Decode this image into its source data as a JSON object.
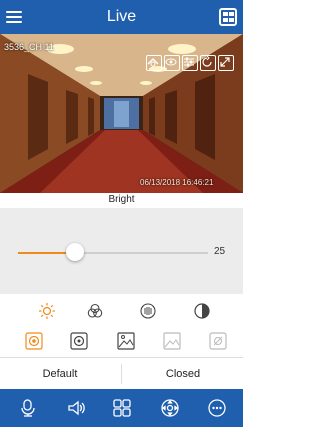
{
  "header": {
    "title": "Live"
  },
  "video": {
    "channel_label": "3536_CH 11",
    "timestamp": "06/13/2018 16:46:21",
    "controls": [
      "snapshot-icon",
      "eye-icon",
      "sliders-icon",
      "rotate-icon",
      "fullscreen-icon"
    ]
  },
  "panel": {
    "param_label": "Bright",
    "slider_value": "25",
    "slider_fraction": 0.3,
    "param_icons": [
      "brightness-icon",
      "contrast-rgb-icon",
      "saturation-icon",
      "hue-icon"
    ],
    "mode_icons": [
      "mode-auto-icon",
      "mode-color-icon",
      "mode-scene-icon",
      "mode-landscape-icon",
      "mode-settings-icon"
    ],
    "default_label": "Default",
    "closed_label": "Closed"
  },
  "tabbar": {
    "items": [
      "talk-icon",
      "audio-icon",
      "split-view-icon",
      "ptz-icon",
      "more-icon"
    ]
  },
  "colors": {
    "header": "#1f5fae",
    "accent": "#f08a1c"
  }
}
